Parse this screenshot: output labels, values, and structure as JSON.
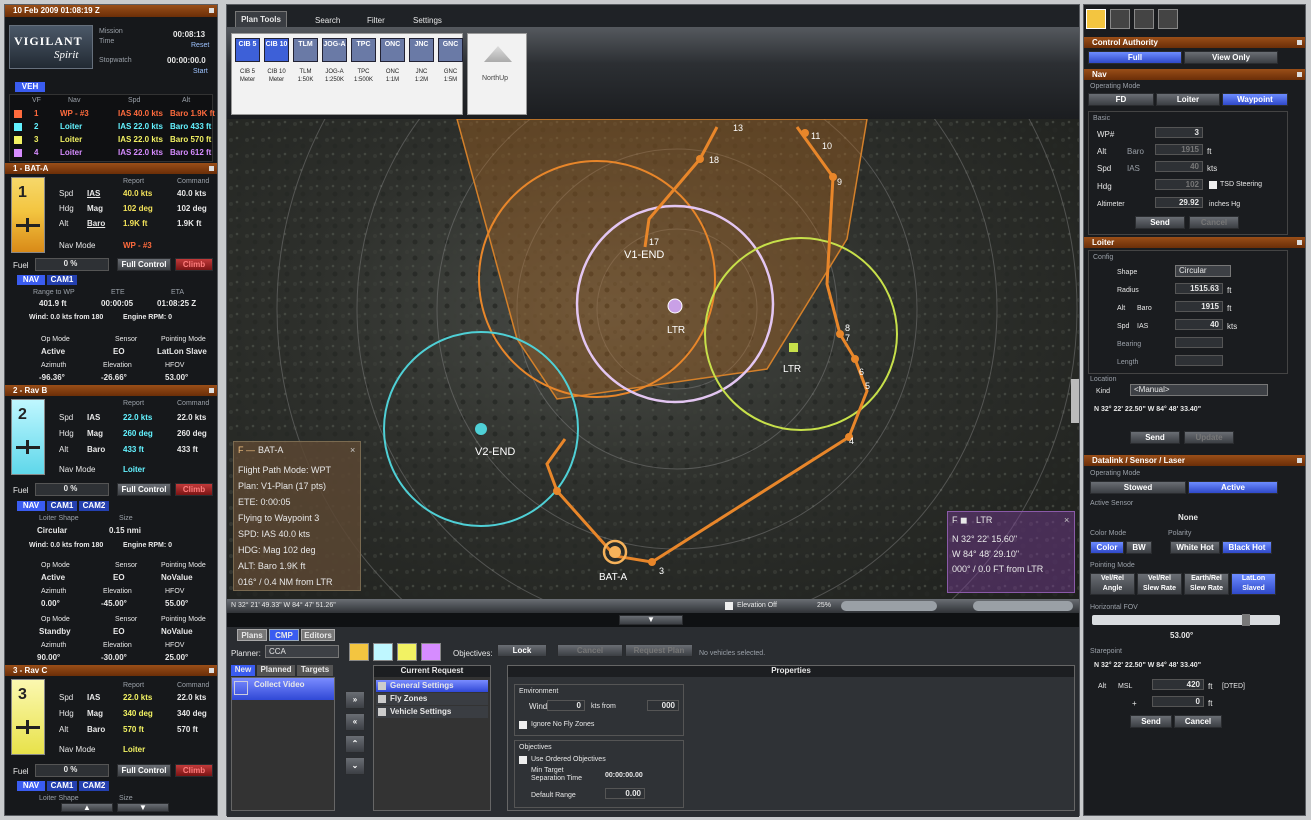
{
  "left": {
    "title": "10 Feb 2009 01:08:19 Z",
    "logo_vigilant": "VIGILANT",
    "logo_spirit": "Spirit",
    "mission_time_label": "Mission\nTime",
    "mission_time": "00:08:13",
    "reset": "Reset",
    "stopwatch_label": "Stopwatch",
    "stopwatch": "00:00:00.0",
    "start": "Start",
    "veh_tab": "VEH",
    "table_header": [
      "VF",
      "Nav",
      "Spd",
      "Alt"
    ],
    "vehicles": [
      {
        "id": "1",
        "nav": "WP - #3",
        "spd": "IAS 40.0 kts",
        "alt": "Baro 1.9K ft",
        "color": "#ff6b3d"
      },
      {
        "id": "2",
        "nav": "Loiter",
        "spd": "IAS 22.0 kts",
        "alt": "Baro 433 ft",
        "color": "#63f2ff"
      },
      {
        "id": "3",
        "nav": "Loiter",
        "spd": "IAS 22.0 kts",
        "alt": "Baro 570 ft",
        "color": "#f2f263"
      },
      {
        "id": "4",
        "nav": "Loiter",
        "spd": "IAS 22.0 kts",
        "alt": "Baro 612 ft",
        "color": "#d68cff"
      }
    ],
    "bat_a": {
      "header": "1 - BAT-A",
      "report": "Report",
      "command": "Command",
      "spd_label": "Spd",
      "spd_mode": "IAS",
      "spd_report": "40.0 kts",
      "spd_cmd": "40.0 kts",
      "hdg_label": "Hdg",
      "hdg_mode": "Mag",
      "hdg_report": "102 deg",
      "hdg_cmd": "102 deg",
      "alt_label": "Alt",
      "alt_mode": "Baro",
      "alt_report": "1.9K ft",
      "alt_cmd": "1.9K ft",
      "nav_mode_label": "Nav Mode",
      "nav_mode": "WP - #3",
      "fuel_label": "Fuel",
      "fuel": "0 %",
      "full_control": "Full Control",
      "climb": "Climb",
      "tabs": [
        "NAV",
        "CAM1"
      ],
      "range_label": "Range to WP",
      "ete_label": "ETE",
      "eta_label": "ETA",
      "range": "401.9 ft",
      "ete": "00:00:05",
      "eta": "01:08:25 Z",
      "wind": "Wind: 0.0 kts from 180",
      "engine": "Engine RPM: 0",
      "op_mode_label": "Op Mode",
      "sensor_label": "Sensor",
      "pointing_label": "Pointing Mode",
      "op_mode": "Active",
      "sensor": "EO",
      "pointing": "LatLon Slave",
      "azimuth_label": "Azimuth",
      "elevation_label": "Elevation",
      "hfov_label": "HFOV",
      "azimuth": "-96.36°",
      "elevation": "-26.66°",
      "hfov": "53.00°"
    },
    "bat_b": {
      "header": "2 - Rav B",
      "report": "Report",
      "command": "Command",
      "spd_report": "22.0 kts",
      "spd_cmd": "22.0 kts",
      "hdg_report": "260 deg",
      "hdg_cmd": "260 deg",
      "alt_report": "433 ft",
      "alt_cmd": "433 ft",
      "nav_mode": "Loiter",
      "fuel": "0 %",
      "full_control": "Full Control",
      "climb": "Climb",
      "tabs": [
        "NAV",
        "CAM1",
        "CAM2"
      ],
      "loiter_shape_label": "Loiter Shape",
      "size_label": "Size",
      "loiter_shape": "Circular",
      "size": "0.15 nmi",
      "wind": "Wind: 0.0 kts from 180",
      "engine": "Engine RPM: 0",
      "cam1": {
        "op_mode": "Active",
        "sensor": "EO",
        "pointing": "NoValue",
        "azimuth": "0.00°",
        "elevation": "-45.00°",
        "hfov": "55.00°"
      },
      "cam2": {
        "op_mode": "Standby",
        "sensor": "EO",
        "pointing": "NoValue",
        "azimuth": "90.00°",
        "elevation": "-30.00°",
        "hfov": "25.00°"
      }
    },
    "bat_c": {
      "header": "3 - Rav C",
      "report": "Report",
      "command": "Command",
      "spd_report": "22.0 kts",
      "spd_cmd": "22.0 kts",
      "hdg_report": "340 deg",
      "hdg_cmd": "340 deg",
      "alt_report": "570 ft",
      "alt_cmd": "570 ft",
      "nav_mode": "Loiter",
      "fuel": "0 %",
      "full_control": "Full Control",
      "climb": "Climb",
      "tabs": [
        "NAV",
        "CAM1",
        "CAM2"
      ],
      "loiter_shape_label": "Loiter Shape",
      "size_label": "Size"
    }
  },
  "center": {
    "top_tabs": [
      "Plan Tools",
      "Search",
      "Filter",
      "Settings"
    ],
    "tool_icons": [
      {
        "code": "CIB 5",
        "label": "CIB 5\nMeter"
      },
      {
        "code": "CIB 10",
        "label": "CIB 10\nMeter"
      },
      {
        "code": "TLM",
        "label": "TLM\n1:50K"
      },
      {
        "code": "JOG-A",
        "label": "JOG-A\n1:250K"
      },
      {
        "code": "TPC",
        "label": "TPC\n1:500K"
      },
      {
        "code": "ONC",
        "label": "ONC\n1:1M"
      },
      {
        "code": "JNC",
        "label": "JNC\n1:2M"
      },
      {
        "code": "GNC",
        "label": "GNC\n1:5M"
      }
    ],
    "northup": "NorthUp",
    "map_labels": {
      "v1_end": "V1-END",
      "v2_end": "V2-END",
      "ltr1": "LTR",
      "ltr2": "LTR",
      "bat_a": "BAT-A",
      "wp_numbers": [
        "13",
        "11",
        "10",
        "9",
        "8",
        "7",
        "6",
        "5",
        "4",
        "3",
        "18",
        "17"
      ]
    },
    "info_box": {
      "title": "BAT-A",
      "lines": [
        "Flight Path Mode: WPT",
        "Plan: V1-Plan (17 pts)",
        "ETE: 0:00:05",
        "Flying to Waypoint 3",
        "SPD: IAS 40.0 kts",
        "HDG: Mag 102 deg",
        "ALT: Baro 1.9K ft",
        "016° / 0.4 NM from LTR"
      ]
    },
    "ltr_box": {
      "title": "LTR",
      "lines": [
        "N 32° 22' 15.60\"",
        "W 84° 48' 29.10\"",
        "000° / 0.0 FT from LTR"
      ]
    },
    "status_bar": {
      "coords": "N 32° 21' 49.33\" W 84° 47' 51.26\"",
      "elevation_off": "Elevation Off",
      "zoom": "25%"
    },
    "bottom_tabs": [
      "Plans",
      "CMP",
      "Editors"
    ],
    "planner_label": "Planner:",
    "planner_value": "CCA",
    "objectives_label": "Objectives:",
    "lock": "Lock",
    "cancel": "Cancel",
    "request_plan": "Request Plan",
    "no_vehicles": "No vehicles selected.",
    "subtabs": [
      "New",
      "Planned",
      "Targets"
    ],
    "collect_video": "Collect Video",
    "current_request": "Current Request",
    "request_items": [
      "General Settings",
      "Fly Zones",
      "Vehicle Settings"
    ],
    "properties": "Properties",
    "environment": "Environment",
    "wind_label": "Wind:",
    "wind_value": "0",
    "kts_from": "kts  from",
    "from_value": "000",
    "ignore_nfz": "Ignore No Fly Zones",
    "objectives": "Objectives",
    "use_ordered": "Use Ordered Objectives",
    "min_target": "Min Target\nSeparation Time",
    "min_target_value": "00:00:00.00",
    "default_range": "Default Range",
    "default_range_value": "0.00"
  },
  "right": {
    "control_authority": "Control Authority",
    "full": "Full",
    "view_only": "View Only",
    "nav": "Nav",
    "operating_mode": "Operating Mode",
    "fd": "FD",
    "loiter": "Loiter",
    "waypoint": "Waypoint",
    "basic": "Basic",
    "wp_label": "WP#",
    "wp_value": "3",
    "alt_label": "Alt",
    "alt_mode": "Baro",
    "alt_value": "1915",
    "ft": "ft",
    "spd_label": "Spd",
    "spd_mode": "IAS",
    "spd_value": "40",
    "kts": "kts",
    "hdg_label": "Hdg",
    "hdg_value": "102",
    "tsd_steering": "TSD Steering",
    "altimeter_label": "Altimeter",
    "altimeter_value": "29.92",
    "inches_hg": "inches Hg",
    "send": "Send",
    "cancel": "Cancel",
    "loiter_header": "Loiter",
    "config": "Config",
    "shape_label": "Shape",
    "shape_value": "Circular",
    "radius_label": "Radius",
    "radius_value": "1515.63",
    "radius_unit": "ft",
    "l_alt_label": "Alt",
    "l_alt_mode": "Baro",
    "l_alt_value": "1915",
    "l_spd_label": "Spd",
    "l_spd_mode": "IAS",
    "l_spd_value": "40",
    "bearing_label": "Bearing",
    "length_label": "Length",
    "location": "Location",
    "kind_label": "Kind",
    "kind_value": "<Manual>",
    "loc_coords": "N 32° 22' 22.50\" W 84° 48' 33.40\"",
    "update": "Update",
    "sensor_header": "Datalink / Sensor / Laser",
    "op_mode": "Operating Mode",
    "stowed": "Stowed",
    "active": "Active",
    "active_sensor": "Active Sensor",
    "none": "None",
    "color_mode": "Color Mode",
    "polarity": "Polarity",
    "color": "Color",
    "bw": "BW",
    "white_hot": "White Hot",
    "black_hot": "Black Hot",
    "pointing_mode": "Pointing Mode",
    "pointing_buttons": [
      "Vel/Rel\nAngle",
      "Vel/Rel\nSlew Rate",
      "Earth/Rel\nSlew Rate",
      "LatLon\nSlaved"
    ],
    "hfov_label": "Horizontal FOV",
    "hfov_value": "53.00°",
    "starepoint": "Starepoint",
    "stare_coords": "N 32° 22' 22.50\" W 84° 48' 33.40\"",
    "s_alt_label": "Alt",
    "msl": "MSL",
    "s_alt_value": "420",
    "dted": "[DTED]",
    "plus": "+",
    "plus_value": "0"
  }
}
